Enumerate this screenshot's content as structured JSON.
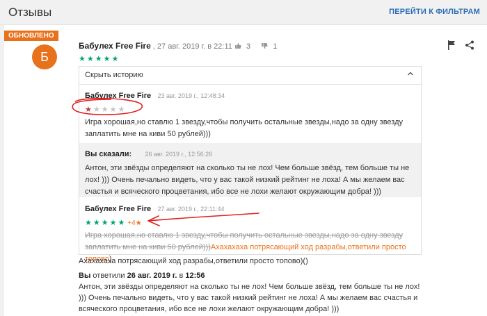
{
  "header": {
    "title": "Отзывы",
    "filters_link": "ПЕРЕЙТИ К ФИЛЬТРАМ"
  },
  "badge": {
    "label": "ОБНОВЛЕНО"
  },
  "review": {
    "avatar_letter": "Б",
    "author": "Бабулех Free Fire",
    "date": ", 27 авг. 2019 г. в 22:11",
    "likes": "3",
    "dislikes": "1",
    "rating": 5,
    "stars": "★★★★★"
  },
  "history": {
    "toggle_label": "Скрыть историю",
    "entries": [
      {
        "author": "Бабулех Free Fire",
        "date": "23 авг. 2019 г., 12:48:34",
        "rating": 1,
        "stars_on": "★",
        "stars_off": "★★★★",
        "text": "Игра хорошая,но ставлю 1 звезду,чтобы получить остальные звезды,надо за одну звезду заплатить мне на киви 50 рублей)))"
      },
      {
        "label": "Вы сказали:",
        "date": "26 авг. 2019 г., 12:56:26",
        "text": "Антон, эти звёзды определяют на сколько ты не лох! Чем больше звёзд, тем больше ты не лох! ))) Очень печально видеть, что у вас такой низкий рейтинг не лоха! А мы желаем вас счастья и всяческого процветания, ибо все не лохи желают окружающим добра! )))"
      },
      {
        "author": "Бабулех Free Fire",
        "date": "27 авг. 2019 г., 22:11:44",
        "rating": 5,
        "stars": "★★★★★",
        "delta": "+4★",
        "struck_text": "Игра хорошая,но ставлю 1 звезду,чтобы получить остальные звезды,надо за одну звезду заплатить мне на киви 50 рублей)))",
        "added_text": "Ахахахаха потрясающий ход разрабы,ответили просто топово",
        "tail": ")"
      }
    ]
  },
  "current_text": "Ахахахаха потрясающий ход разрабы,ответили просто топово)()",
  "developer_reply": {
    "who": "Вы",
    "verb": " ответили ",
    "date": "26 авг. 2019 г.",
    "at": " в ",
    "time": "12:56",
    "text": "Антон, эти звёзды определяют на сколько ты не лох! Чем больше звёзд, тем больше ты не лох! ))) Очень печально видеть, что у вас такой низкий рейтинг не лоха! А мы желаем вас счастья и всяческого процветания, ибо все не лохи желают окружающим добра! )))"
  },
  "colors": {
    "accent": "#e8711c",
    "stars": "#00a173",
    "link": "#2a6db6",
    "annotation": "#e02020"
  }
}
